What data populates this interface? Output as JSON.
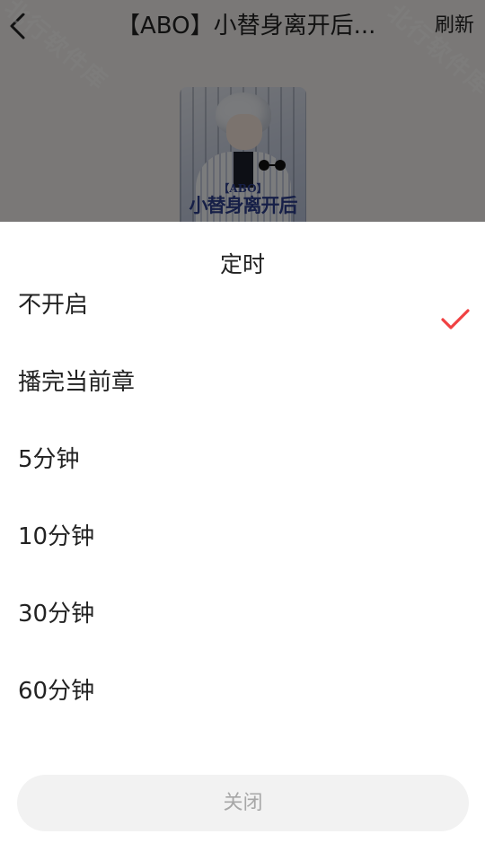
{
  "header": {
    "title": "【ABO】小替身离开后...",
    "refresh_label": "刷新",
    "back_icon": "chevron-left-icon"
  },
  "cover": {
    "caption_small": "【ABO】",
    "caption_big": "小替身离开后"
  },
  "watermark": {
    "text": "北行软件库"
  },
  "timer_sheet": {
    "title": "定时",
    "options": [
      {
        "label": "不开启",
        "selected": true
      },
      {
        "label": "播完当前章",
        "selected": false
      },
      {
        "label": "5分钟",
        "selected": false
      },
      {
        "label": "10分钟",
        "selected": false
      },
      {
        "label": "30分钟",
        "selected": false
      },
      {
        "label": "60分钟",
        "selected": false
      }
    ],
    "check_icon": "checkmark-icon",
    "check_color": "#f04142",
    "close_label": "关闭"
  },
  "colors": {
    "overlay": "rgba(0,0,0,0.5)",
    "text": "#222222",
    "close_text": "#a7a7a7",
    "close_bg": "#f2f2f2"
  }
}
